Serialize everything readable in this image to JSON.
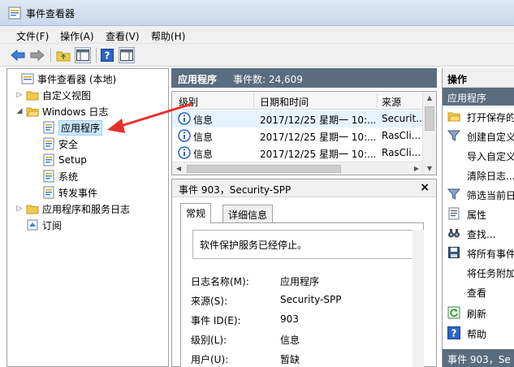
{
  "window": {
    "title": "事件查看器"
  },
  "menu": [
    "文件(F)",
    "操作(A)",
    "查看(V)",
    "帮助(H)"
  ],
  "tree": {
    "root": "事件查看器 (本地)",
    "custom_views": "自定义视图",
    "windows_logs": "Windows 日志",
    "logs": [
      "应用程序",
      "安全",
      "Setup",
      "系统",
      "转发事件"
    ],
    "app_service_logs": "应用程序和服务日志",
    "subscriptions": "订阅"
  },
  "events_header": {
    "title": "应用程序",
    "count_label": "事件数: 24,609"
  },
  "events_table": {
    "columns": [
      "级别",
      "日期和时间",
      "来源"
    ],
    "rows": [
      {
        "level": "信息",
        "datetime": "2017/12/25 星期一 10:...",
        "source": "Securit..."
      },
      {
        "level": "信息",
        "datetime": "2017/12/25 星期一 10:...",
        "source": "RasCli..."
      },
      {
        "level": "信息",
        "datetime": "2017/12/25 星期一 10:...",
        "source": "RasCli..."
      }
    ]
  },
  "event_detail": {
    "title": "事件 903，Security-SPP",
    "tabs": [
      "常规",
      "详细信息"
    ],
    "description": "软件保护服务已经停止。",
    "fields": [
      {
        "label": "日志名称(M):",
        "value": "应用程序"
      },
      {
        "label": "来源(S):",
        "value": "Security-SPP"
      },
      {
        "label": "事件 ID(E):",
        "value": "903"
      },
      {
        "label": "级别(L):",
        "value": "信息"
      },
      {
        "label": "用户(U):",
        "value": "暂缺"
      }
    ]
  },
  "actions": {
    "header": "操作",
    "section": "应用程序",
    "items": [
      "打开保存的",
      "创建自定义",
      "导入自定义",
      "清除日志...",
      "筛选当前日",
      "属性",
      "查找...",
      "将所有事件",
      "将任务附加",
      "查看",
      "刷新",
      "帮助"
    ],
    "footer": "事件 903，Se"
  },
  "colors": {
    "header_bg": "#5a6c80",
    "annotation": "#e8302a",
    "selection": "#cce8ff"
  }
}
